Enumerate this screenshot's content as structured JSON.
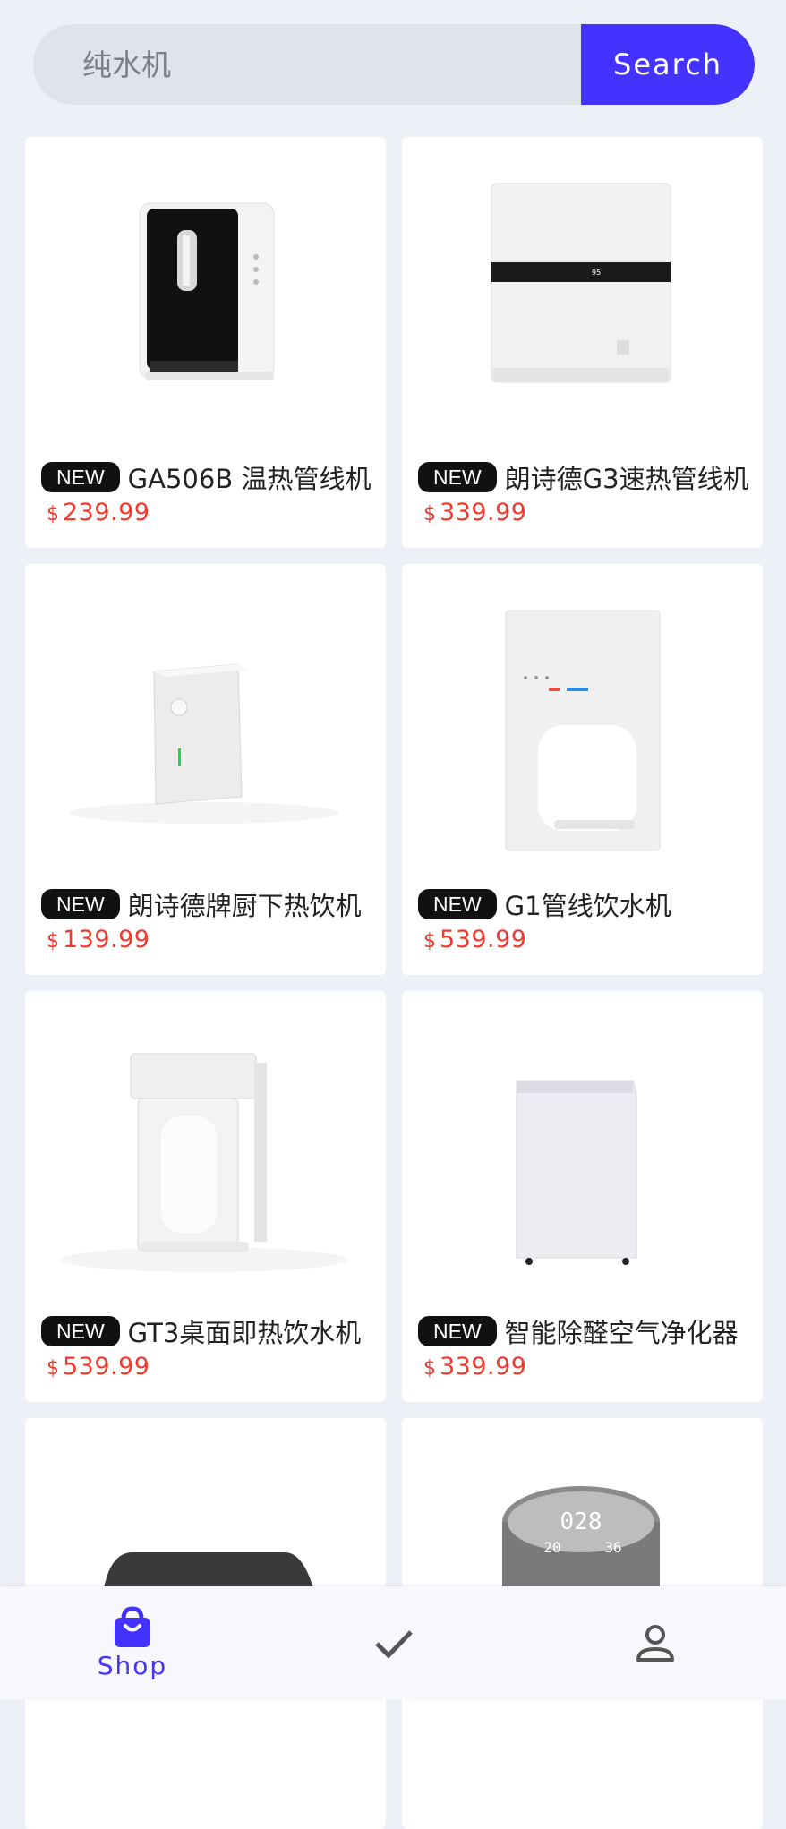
{
  "search": {
    "placeholder": "纯水机",
    "button_label": "Search"
  },
  "accent_color": "#4433ff",
  "price_color": "#f03a2e",
  "products": [
    {
      "badge": "NEW",
      "title": "GA506B 温热管线机",
      "currency": "$",
      "price": "239.99",
      "image_icon": "water-dispenser-black-front"
    },
    {
      "badge": "NEW",
      "title": "朗诗德G3速热管线机",
      "currency": "$",
      "price": "339.99",
      "image_icon": "water-dispenser-white-display"
    },
    {
      "badge": "NEW",
      "title": "朗诗德牌厨下热饮机",
      "currency": "$",
      "price": "139.99",
      "image_icon": "compact-heater-white"
    },
    {
      "badge": "NEW",
      "title": "G1管线饮水机",
      "currency": "$",
      "price": "539.99",
      "image_icon": "water-dispenser-white-tall"
    },
    {
      "badge": "NEW",
      "title": "GT3桌面即热饮水机",
      "currency": "$",
      "price": "539.99",
      "image_icon": "countertop-dispenser"
    },
    {
      "badge": "NEW",
      "title": "智能除醛空气净化器",
      "currency": "$",
      "price": "339.99",
      "image_icon": "air-purifier"
    },
    {
      "image_icon": "dark-device"
    },
    {
      "image_icon": "round-display-device",
      "display_text": "028",
      "left_text": "20",
      "right_text": "36"
    }
  ],
  "nav": {
    "shop_label": "Shop",
    "shop_icon": "shopping-bag-icon",
    "check_icon": "check-icon",
    "profile_icon": "person-icon"
  }
}
